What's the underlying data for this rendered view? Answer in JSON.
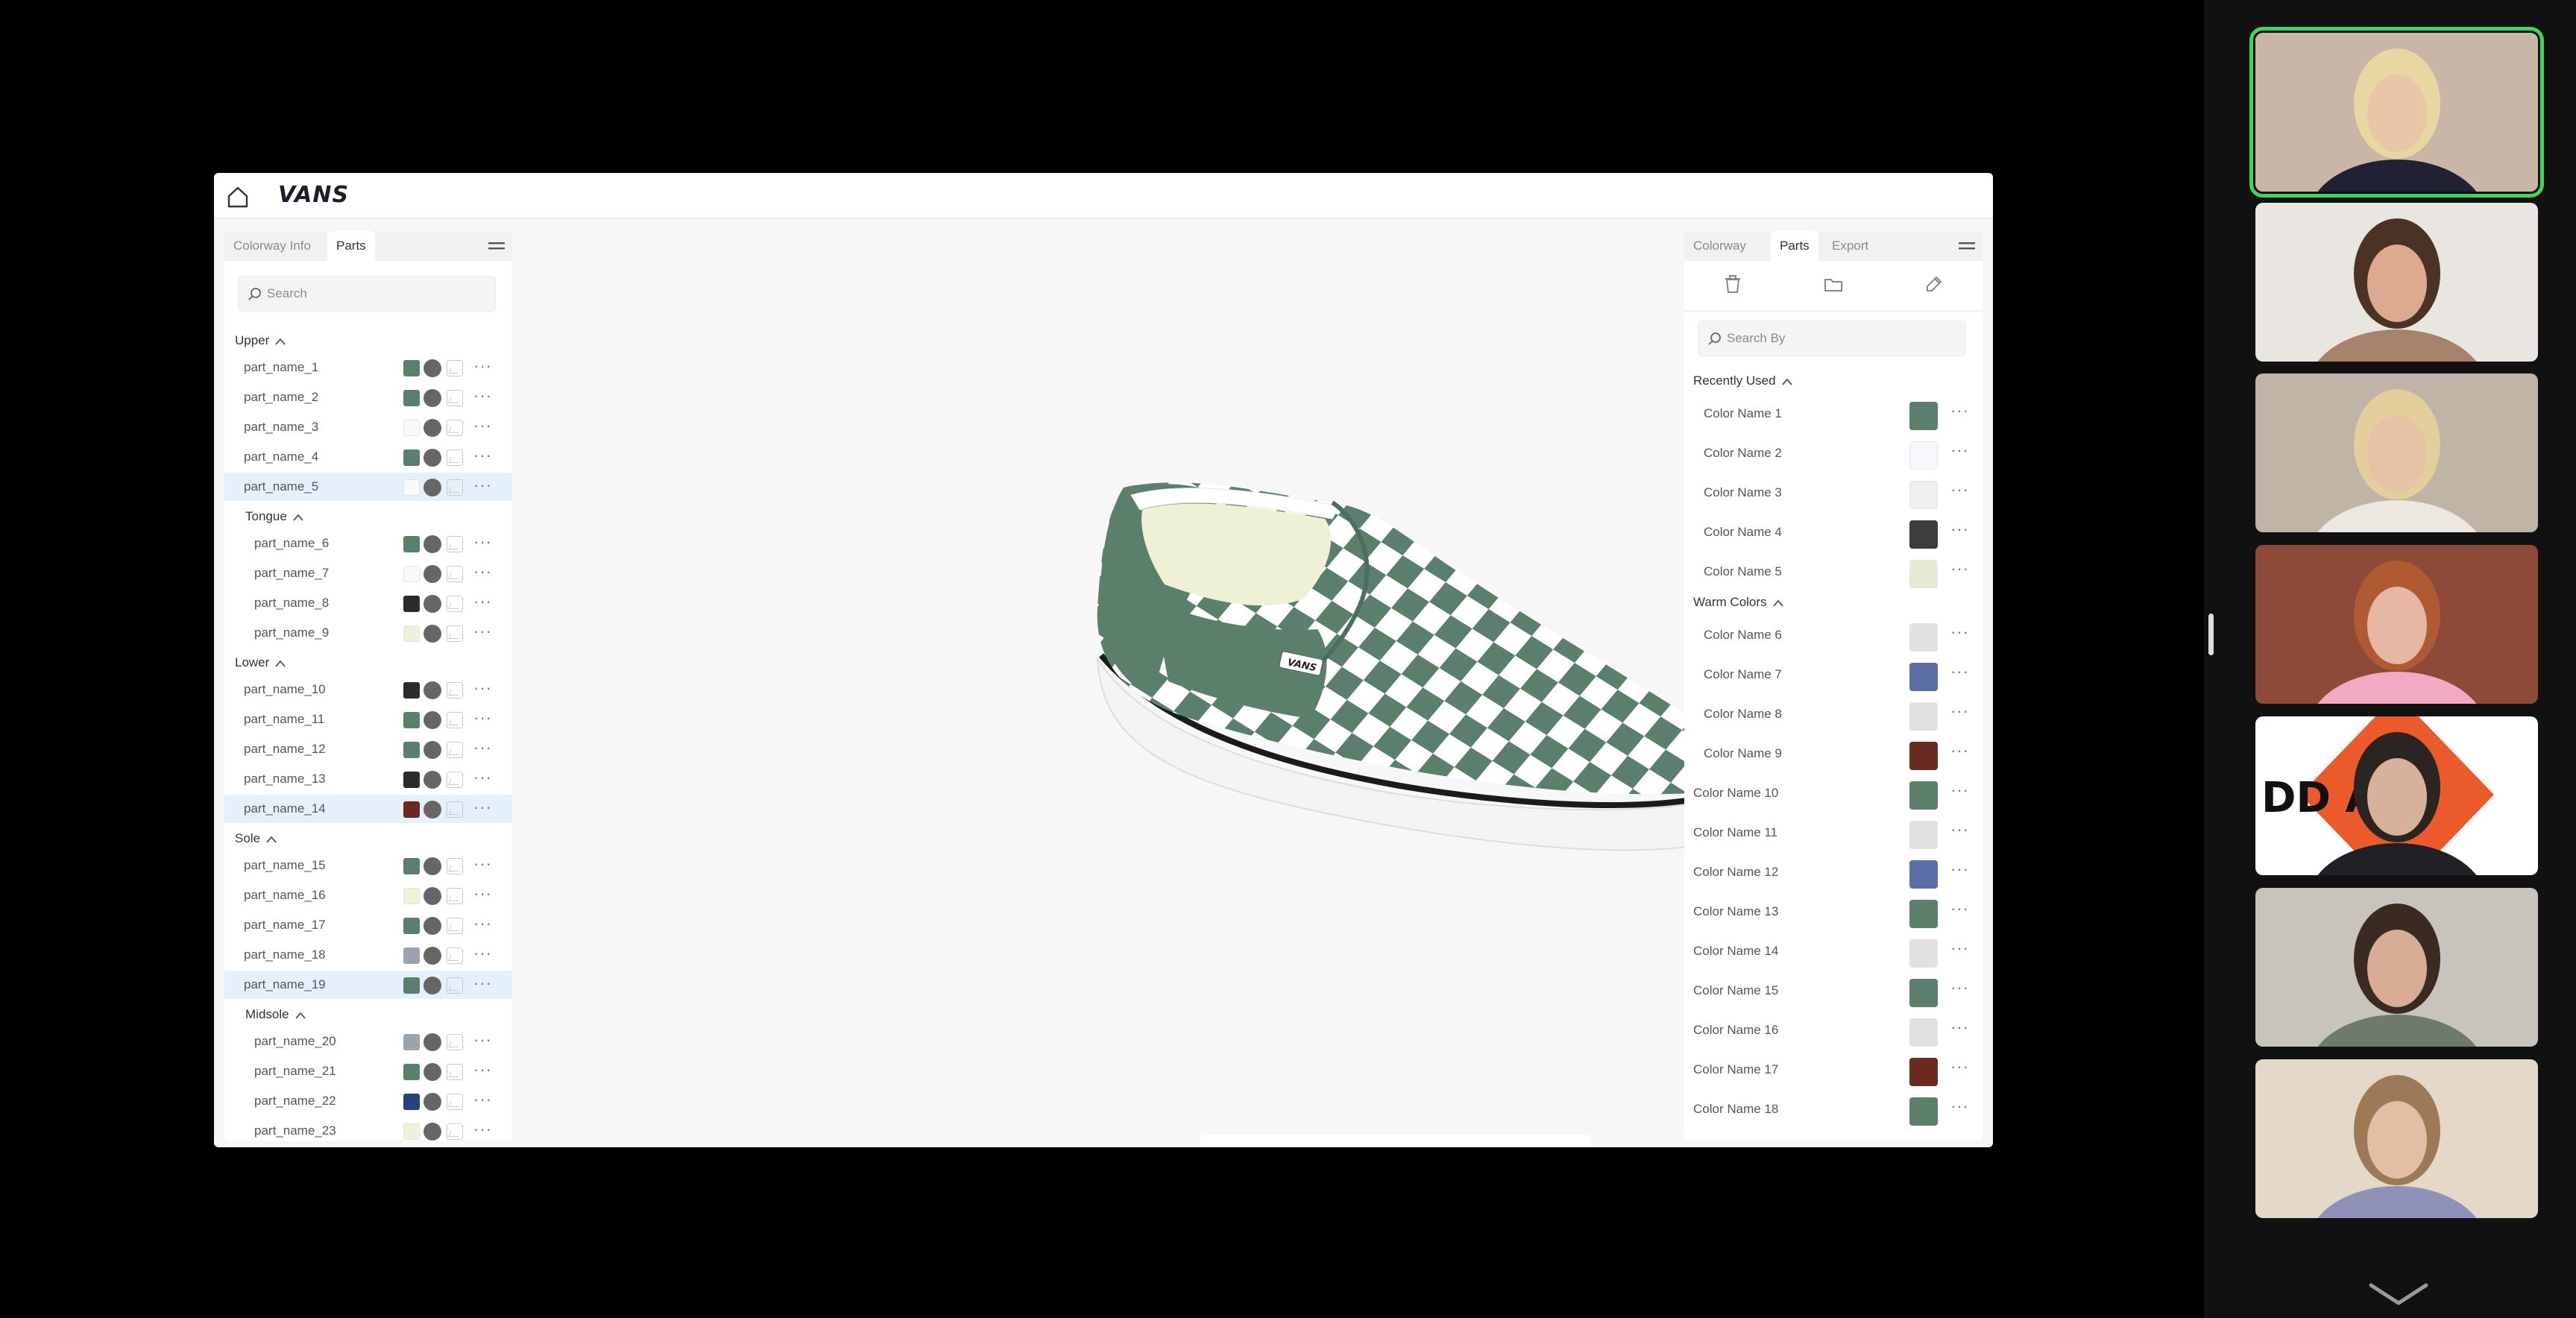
{
  "app": {
    "brand": "VANS",
    "left_panel": {
      "tabs": [
        "Colorway Info",
        "Parts"
      ],
      "active_tab": 1,
      "search_placeholder": "Search",
      "groups": [
        {
          "name": "Upper",
          "indent": false,
          "parts": [
            {
              "name": "part_name_1",
              "swatch": "#5a7f6b",
              "selected": false
            },
            {
              "name": "part_name_2",
              "swatch": "#5a7f6b",
              "selected": false
            },
            {
              "name": "part_name_3",
              "swatch": "#fafafa",
              "selected": false
            },
            {
              "name": "part_name_4",
              "swatch": "#5a7f6b",
              "selected": false
            },
            {
              "name": "part_name_5",
              "swatch": "#fafafa",
              "selected": true
            }
          ]
        },
        {
          "name": "Tongue",
          "indent": true,
          "parts": [
            {
              "name": "part_name_6",
              "swatch": "#5a7f6b",
              "selected": false
            },
            {
              "name": "part_name_7",
              "swatch": "#fafafa",
              "selected": false
            },
            {
              "name": "part_name_8",
              "swatch": "#2b2b2b",
              "selected": false
            },
            {
              "name": "part_name_9",
              "swatch": "#eef1d6",
              "selected": false
            }
          ]
        },
        {
          "name": "Lower",
          "indent": false,
          "parts": [
            {
              "name": "part_name_10",
              "swatch": "#2b2b2b",
              "selected": false
            },
            {
              "name": "part_name_11",
              "swatch": "#5a7f6b",
              "selected": false
            },
            {
              "name": "part_name_12",
              "swatch": "#5a7f6b",
              "selected": false
            },
            {
              "name": "part_name_13",
              "swatch": "#2b2b2b",
              "selected": false
            },
            {
              "name": "part_name_14",
              "swatch": "#6b2a1f",
              "selected": true
            }
          ]
        },
        {
          "name": "Sole",
          "indent": false,
          "parts": [
            {
              "name": "part_name_15",
              "swatch": "#5a7f6b",
              "selected": false
            },
            {
              "name": "part_name_16",
              "swatch": "#eef1d6",
              "selected": false
            },
            {
              "name": "part_name_17",
              "swatch": "#5a7f6b",
              "selected": false
            },
            {
              "name": "part_name_18",
              "swatch": "#9aa3ae",
              "selected": false
            },
            {
              "name": "part_name_19",
              "swatch": "#5a7f6b",
              "selected": true
            }
          ]
        },
        {
          "name": "Midsole",
          "indent": true,
          "parts": [
            {
              "name": "part_name_20",
              "swatch": "#9aa3ae",
              "selected": false
            },
            {
              "name": "part_name_21",
              "swatch": "#5a7f6b",
              "selected": false
            },
            {
              "name": "part_name_22",
              "swatch": "#27407e",
              "selected": false
            },
            {
              "name": "part_name_23",
              "swatch": "#eef1d6",
              "selected": false
            }
          ]
        }
      ]
    },
    "right_panel": {
      "tabs": [
        "Colorway",
        "Parts",
        "Export"
      ],
      "active_tab": 1,
      "actions": [
        "trash-icon",
        "folder-icon",
        "eyedropper-icon"
      ],
      "search_placeholder": "Search By",
      "groups": [
        {
          "name": "Recently Used",
          "colors": [
            {
              "name": "Color Name 1",
              "hex": "#5a7f6b",
              "indent": true
            },
            {
              "name": "Color Name 2",
              "hex": "#f7f8fb",
              "indent": true
            },
            {
              "name": "Color Name 3",
              "hex": "#f0f0f0",
              "indent": true
            },
            {
              "name": "Color Name 4",
              "hex": "#3d3d3d",
              "indent": true
            },
            {
              "name": "Color Name 5",
              "hex": "#e6ebd1",
              "indent": true
            }
          ]
        },
        {
          "name": "Warm Colors",
          "colors": [
            {
              "name": "Color Name 6",
              "hex": "#e1e1e1",
              "indent": true
            },
            {
              "name": "Color Name 7",
              "hex": "#5b6ea6",
              "indent": true
            },
            {
              "name": "Color Name 8",
              "hex": "#e1e1e1",
              "indent": true
            },
            {
              "name": "Color Name 9",
              "hex": "#6b2a1f",
              "indent": true
            },
            {
              "name": "Color Name 10",
              "hex": "#5a7f6b",
              "indent": false
            },
            {
              "name": "Color Name 11",
              "hex": "#e1e1e1",
              "indent": false
            },
            {
              "name": "Color Name 12",
              "hex": "#5b6ea6",
              "indent": false
            },
            {
              "name": "Color Name 13",
              "hex": "#5a7f6b",
              "indent": false
            },
            {
              "name": "Color Name 14",
              "hex": "#e1e1e1",
              "indent": false
            },
            {
              "name": "Color Name 15",
              "hex": "#5a7f6b",
              "indent": false
            },
            {
              "name": "Color Name 16",
              "hex": "#e1e1e1",
              "indent": false
            },
            {
              "name": "Color Name 17",
              "hex": "#6b2a1f",
              "indent": false
            },
            {
              "name": "Color Name 18",
              "hex": "#5a7f6b",
              "indent": false
            }
          ]
        }
      ]
    },
    "toolbar": [
      "pointer-icon",
      "add-icon",
      "notes-icon",
      "hide-icon",
      "save-icon",
      "undo-icon",
      "redo-icon"
    ],
    "shoe_colors": {
      "primary": "#5a7f6b",
      "secondary": "#ffffff",
      "lining": "#eef1d6",
      "stripe": "#1b1b1b"
    }
  },
  "participants": [
    {
      "name": "participant-1",
      "speaking": true,
      "bg": "#c9b6a6",
      "skin": "#e8c7a8",
      "hair": "#e9d7a2",
      "shirt": "#1f2232"
    },
    {
      "name": "participant-2",
      "speaking": false,
      "bg": "#e9e6e2",
      "skin": "#dcaa8e",
      "hair": "#4a3325",
      "shirt": "#a7826c"
    },
    {
      "name": "participant-3",
      "speaking": false,
      "bg": "#bfb4a6",
      "skin": "#e6c3a6",
      "hair": "#e4cf9c",
      "shirt": "#ece7e1"
    },
    {
      "name": "participant-4",
      "speaking": false,
      "bg": "#8d4a38",
      "skin": "#e4b8a2",
      "hair": "#b05a34",
      "shirt": "#f2a9c2"
    },
    {
      "name": "participant-5",
      "speaking": false,
      "bg": "#ffffff",
      "skin": "#d8b19a",
      "hair": "#2b2522",
      "shirt": "#1f2127",
      "logo": "DD  AM"
    },
    {
      "name": "participant-6",
      "speaking": false,
      "bg": "#c8c3bd",
      "skin": "#d7ad95",
      "hair": "#3b2a22",
      "shirt": "#6e7a6c"
    },
    {
      "name": "participant-7",
      "speaking": false,
      "bg": "#e4d8c8",
      "skin": "#e3bea4",
      "hair": "#9c7a57",
      "shirt": "#8f91b8"
    }
  ]
}
